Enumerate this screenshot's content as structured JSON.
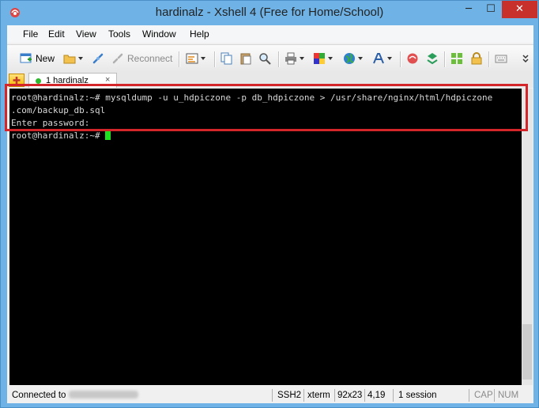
{
  "window": {
    "title": "hardinalz - Xshell 4 (Free for Home/School)",
    "minimize_glyph": "─",
    "maximize_glyph": "☐",
    "close_glyph": "✕"
  },
  "menu": [
    "File",
    "Edit",
    "View",
    "Tools",
    "Window",
    "Help"
  ],
  "toolbar": {
    "new_label": "New",
    "reconnect_label": "Reconnect"
  },
  "tab": {
    "add_glyph": "+",
    "label": "1 hardinalz",
    "close_glyph": "×"
  },
  "terminal": {
    "lines": [
      "root@hardinalz:~# mysqldump -u u_hdpiczone -p db_hdpiczone > /usr/share/nginx/html/hdpiczone",
      ".com/backup_db.sql",
      "Enter password:",
      "root@hardinalz:~# "
    ]
  },
  "status": {
    "connected": "Connected to",
    "protocol": "SSH2",
    "term": "xterm",
    "size": "92x23",
    "position": "4,19",
    "sessions": "1 session",
    "cap": "CAP",
    "num": "NUM"
  },
  "colors": {
    "close_button": "#c7302b",
    "cursor": "#1fe01f",
    "highlight_box": "#d4262a",
    "terminal_bg": "#000000"
  }
}
